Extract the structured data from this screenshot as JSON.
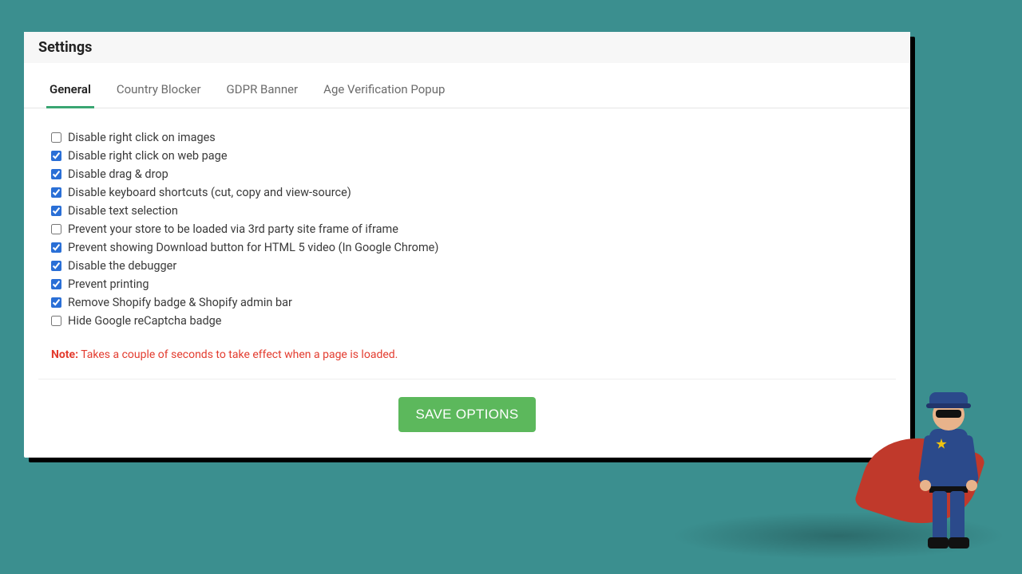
{
  "header": {
    "title": "Settings"
  },
  "tabs": [
    {
      "label": "General",
      "active": true
    },
    {
      "label": "Country Blocker",
      "active": false
    },
    {
      "label": "GDPR Banner",
      "active": false
    },
    {
      "label": "Age Verification Popup",
      "active": false
    }
  ],
  "options": [
    {
      "label": "Disable right click on images",
      "checked": false
    },
    {
      "label": "Disable right click on web page",
      "checked": true
    },
    {
      "label": "Disable drag & drop",
      "checked": true
    },
    {
      "label": "Disable keyboard shortcuts (cut, copy and view-source)",
      "checked": true
    },
    {
      "label": "Disable text selection",
      "checked": true
    },
    {
      "label": "Prevent your store to be loaded via 3rd party site frame of iframe",
      "checked": false
    },
    {
      "label": "Prevent showing Download button for HTML 5 video (In Google Chrome)",
      "checked": true
    },
    {
      "label": "Disable the debugger",
      "checked": true
    },
    {
      "label": "Prevent printing",
      "checked": true
    },
    {
      "label": "Remove Shopify badge & Shopify admin bar",
      "checked": true
    },
    {
      "label": "Hide Google reCaptcha badge",
      "checked": false
    }
  ],
  "note": {
    "label": "Note:",
    "text": " Takes a couple of seconds to take effect when a page is loaded."
  },
  "buttons": {
    "save": "SAVE OPTIONS"
  }
}
